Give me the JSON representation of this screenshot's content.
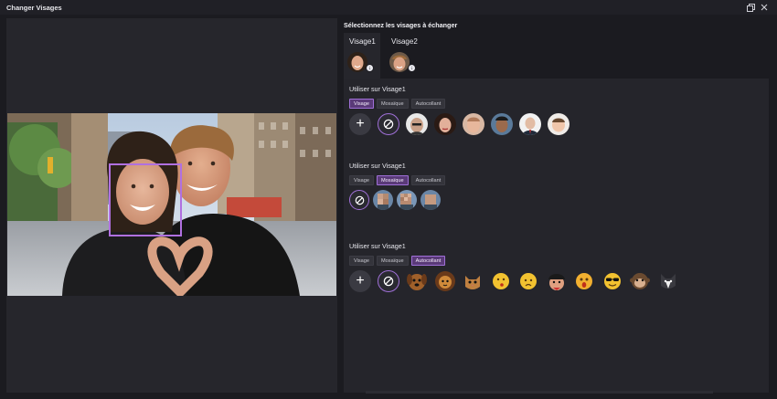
{
  "window": {
    "title": "Changer Visages"
  },
  "titlebar": {
    "restore_icon": "restore-window-icon",
    "close_icon": "close-icon"
  },
  "right": {
    "section_title": "Sélectionnez les visages à échanger",
    "faces": [
      {
        "label": "Visage1",
        "active": true
      },
      {
        "label": "Visage2",
        "active": false
      }
    ]
  },
  "groups": [
    {
      "title": "Utiliser sur Visage1",
      "tabs": [
        "Visage",
        "Mosaïque",
        "Autocollant"
      ],
      "selected": "Visage"
    },
    {
      "title": "Utiliser sur Visage1",
      "tabs": [
        "Visage",
        "Mosaïque",
        "Autocollant"
      ],
      "selected": "Mosaïque"
    },
    {
      "title": "Utiliser sur Visage1",
      "tabs": [
        "Visage",
        "Mosaïque",
        "Autocollant"
      ],
      "selected": "Autocollant"
    }
  ],
  "colors": {
    "accent": "#a070d8",
    "face_box": "#b070e0",
    "panel": "#26262c",
    "background": "#1b1b20"
  }
}
